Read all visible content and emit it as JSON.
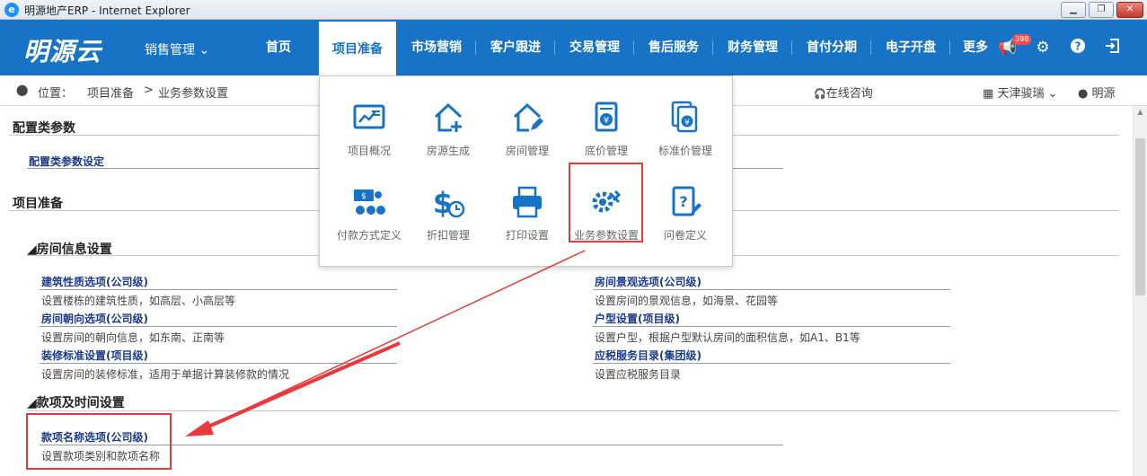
{
  "window": {
    "title": "明源地产ERP - Internet Explorer",
    "ie_icon": "e"
  },
  "header": {
    "logo": "明源云",
    "module_select": "销售管理 ⌄",
    "nav": [
      "首页",
      "项目准备",
      "市场营销",
      "客户跟进",
      "交易管理",
      "售后服务",
      "财务管理",
      "首付分期",
      "电子开盘",
      "更多"
    ],
    "badge": "398",
    "icons": [
      "announcement-icon",
      "gear-icon",
      "help-icon",
      "logout-icon"
    ]
  },
  "location": {
    "label": "位置：",
    "crumb1": "项目准备",
    "sep": ">",
    "crumb2": "业务参数设置",
    "consult": "在线咨询",
    "company": "天津骏瑞",
    "user": "明源"
  },
  "dropdown": {
    "items": [
      {
        "label": "项目概况",
        "icon": "project-overview-icon"
      },
      {
        "label": "房源生成",
        "icon": "house-add-icon"
      },
      {
        "label": "房间管理",
        "icon": "house-edit-icon"
      },
      {
        "label": "底价管理",
        "icon": "price-doc-icon"
      },
      {
        "label": "标准价管理",
        "icon": "standard-price-icon"
      },
      {
        "label": "付款方式定义",
        "icon": "payment-icon"
      },
      {
        "label": "折扣管理",
        "icon": "discount-icon"
      },
      {
        "label": "打印设置",
        "icon": "printer-icon"
      },
      {
        "label": "业务参数设置",
        "icon": "settings-tools-icon"
      },
      {
        "label": "问卷定义",
        "icon": "questionnaire-icon"
      }
    ]
  },
  "content": {
    "sec1": {
      "title": "配置类参数",
      "link": "配置类参数设定"
    },
    "sec2": {
      "title": "项目准备"
    },
    "room": {
      "title": "◢房间信息设置",
      "items": [
        {
          "link": "建筑性质选项(公司级)",
          "desc": "设置楼栋的建筑性质，如高层、小高层等"
        },
        {
          "link": "房间景观选项(公司级)",
          "desc": "设置房间的景观信息，如海景、花园等"
        },
        {
          "link": "房间朝向选项(公司级)",
          "desc": "设置房间的朝向信息，如东南、正南等"
        },
        {
          "link": "户型设置(项目级)",
          "desc": "设置户型，根据户型默认房间的面积信息，如A1、B1等"
        },
        {
          "link": "装修标准设置(项目级)",
          "desc": "设置房间的装修标准，适用于单据计算装修款的情况"
        },
        {
          "link": "应税服务目录(集团级)",
          "desc": "设置应税服务目录"
        }
      ]
    },
    "payment": {
      "title": "◢款项及时间设置",
      "link": "款项名称选项(公司级)",
      "desc": "设置款项类别和款项名称"
    }
  },
  "colors": {
    "brand": "#1773c6",
    "highlight": "#e83a3a",
    "link": "#1a3b8c"
  }
}
